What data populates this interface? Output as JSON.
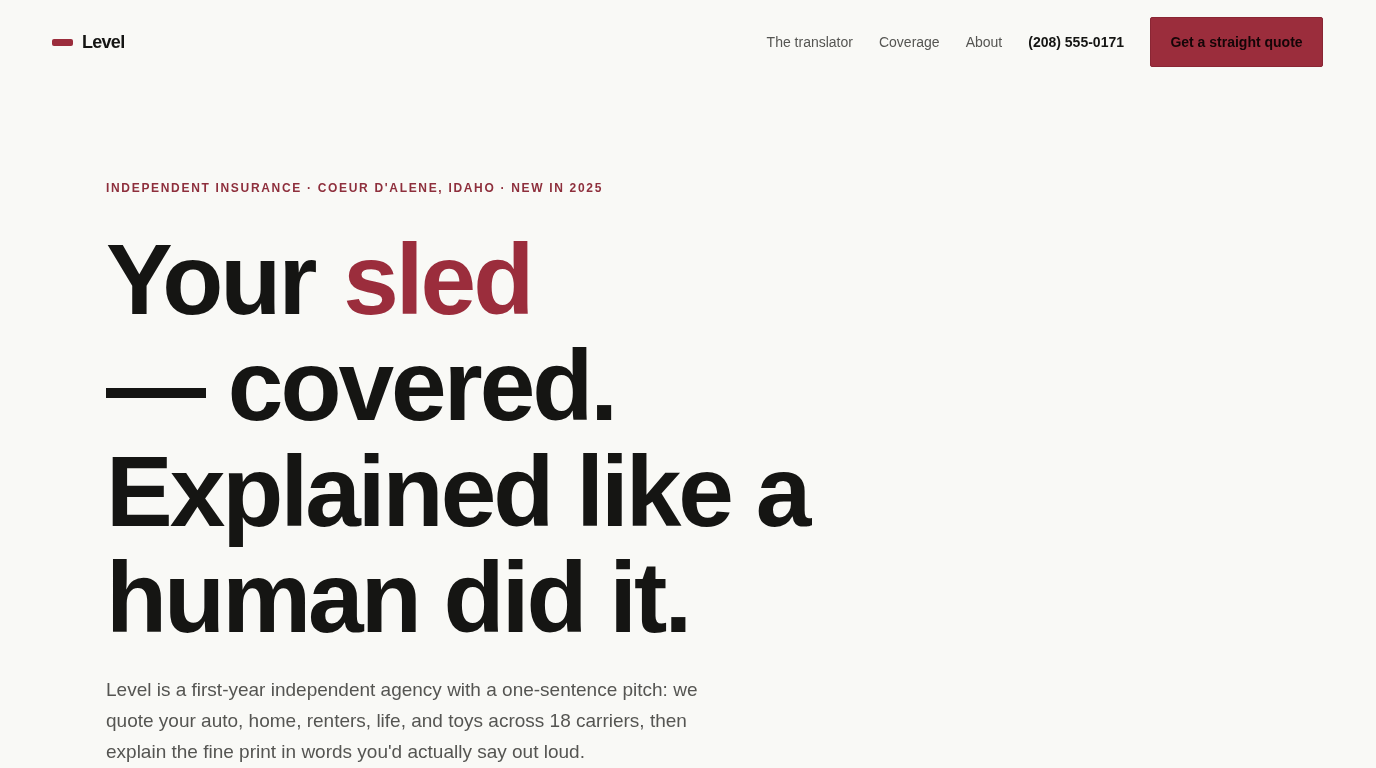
{
  "header": {
    "logo": {
      "text": "Level"
    },
    "nav": [
      {
        "label": "The translator",
        "kind": "link"
      },
      {
        "label": "Coverage",
        "kind": "link"
      },
      {
        "label": "About",
        "kind": "link"
      },
      {
        "label": "(208) 555-0171",
        "kind": "phone"
      }
    ],
    "cta": {
      "label": "Get a straight quote"
    }
  },
  "hero": {
    "eyebrow": "INDEPENDENT INSURANCE · COEUR D'ALENE, IDAHO · NEW IN 2025",
    "headline": {
      "lines": [
        [
          {
            "text": "Your ",
            "accent": false
          },
          {
            "text": "sled",
            "accent": true
          }
        ],
        [
          {
            "text": "— covered.",
            "accent": false
          }
        ],
        [
          {
            "text": "Explained like a",
            "accent": false
          }
        ],
        [
          {
            "text": "human did it.",
            "accent": false
          }
        ]
      ]
    },
    "intro": "Level is a first-year independent agency with a one-sentence pitch: we quote your auto, home, renters, life, and toys across 18 carriers, then explain the fine print in words you'd actually say out loud."
  }
}
